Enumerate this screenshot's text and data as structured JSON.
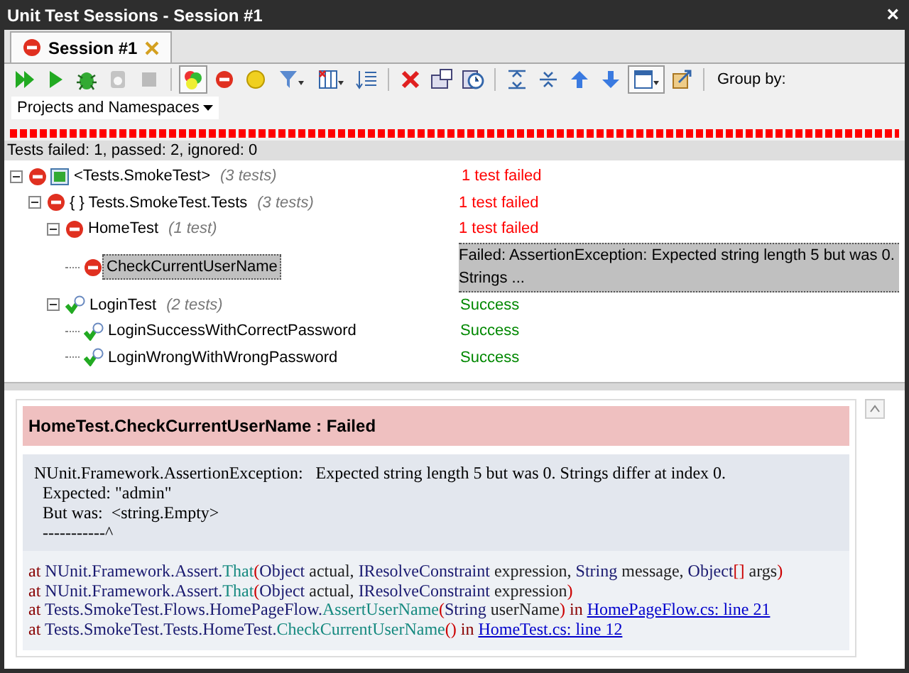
{
  "window": {
    "title": "Unit Test Sessions - Session #1",
    "close": "×"
  },
  "tabs": [
    {
      "label": "Session #1",
      "selected": true,
      "failed": true
    }
  ],
  "toolbar": {
    "buttons": [
      {
        "kind": "run-all",
        "pressed": false,
        "disabled": false
      },
      {
        "kind": "run",
        "pressed": false,
        "disabled": false
      },
      {
        "kind": "debug",
        "pressed": false,
        "disabled": false
      },
      {
        "kind": "profile",
        "pressed": false,
        "disabled": true
      },
      {
        "kind": "stop",
        "pressed": false,
        "disabled": true
      },
      {
        "kind": "sep"
      },
      {
        "kind": "passed",
        "pressed": true,
        "disabled": false
      },
      {
        "kind": "failed",
        "pressed": false,
        "disabled": false
      },
      {
        "kind": "ignored",
        "pressed": false,
        "disabled": false
      },
      {
        "kind": "filter",
        "pressed": false,
        "disabled": false
      },
      {
        "kind": "columns",
        "pressed": false,
        "disabled": false
      },
      {
        "kind": "sort",
        "pressed": false,
        "disabled": false
      },
      {
        "kind": "sep"
      },
      {
        "kind": "remove",
        "pressed": false,
        "disabled": false
      },
      {
        "kind": "export",
        "pressed": false,
        "disabled": false
      },
      {
        "kind": "clock",
        "pressed": false,
        "disabled": false
      },
      {
        "kind": "sep"
      },
      {
        "kind": "expand",
        "pressed": false,
        "disabled": false
      },
      {
        "kind": "collapse",
        "pressed": false,
        "disabled": false
      },
      {
        "kind": "up",
        "pressed": false,
        "disabled": false
      },
      {
        "kind": "down",
        "pressed": false,
        "disabled": false
      },
      {
        "kind": "layout",
        "pressed": true,
        "disabled": false
      },
      {
        "kind": "open",
        "pressed": false,
        "disabled": false
      },
      {
        "kind": "sep"
      }
    ],
    "group_by_label": "Group by:",
    "group_by_value": "Projects and Namespaces"
  },
  "progress": {
    "level": 1,
    "failed": true
  },
  "summary": "Tests failed: 1, passed: 2, ignored: 0",
  "tree": [
    {
      "label": "<Tests.SmokeTest>",
      "count": "(3 tests)",
      "result": "1 test failed",
      "failed": true,
      "project": true,
      "expanded": true,
      "selected": false,
      "children": [
        {
          "label": "{ } Tests.SmokeTest.Tests",
          "count": "(3 tests)",
          "result": "1 test failed",
          "failed": true,
          "expanded": true,
          "selected": false,
          "children": [
            {
              "label": "HomeTest",
              "count": "(1 test)",
              "result": "1 test failed",
              "failed": true,
              "expanded": true,
              "selected": false,
              "children": [
                {
                  "label": "CheckCurrentUserName",
                  "result": "Failed: AssertionException: Expected string length 5 but was 0. Strings ...",
                  "failed": true,
                  "selected": true
                }
              ]
            },
            {
              "label": "LoginTest",
              "count": "(2 tests)",
              "result": "Success",
              "failed": false,
              "expanded": true,
              "selected": false,
              "children": [
                {
                  "label": "LoginSuccessWithCorrectPassword",
                  "result": "Success",
                  "failed": false,
                  "selected": false
                },
                {
                  "label": "LoginWrongWithWrongPassword",
                  "result": "Success",
                  "failed": false,
                  "selected": false
                }
              ]
            }
          ]
        }
      ]
    }
  ],
  "details": {
    "title": "HomeTest.CheckCurrentUserName : Failed",
    "failed": true,
    "message": [
      "NUnit.Framework.AssertionException:   Expected string length 5 but was 0. Strings differ at index 0.",
      "  Expected: \"admin\"",
      "  But was:  <string.Empty>",
      "  -----------^"
    ],
    "stack": [
      [
        {
          "kind": "kw",
          "text": "at "
        },
        {
          "kind": "type",
          "text": "NUnit.Framework.Assert."
        },
        {
          "kind": "method",
          "text": "That"
        },
        {
          "kind": "punct",
          "text": "("
        },
        {
          "kind": "type",
          "text": "Object"
        },
        {
          "kind": "plain",
          "text": " actual, "
        },
        {
          "kind": "type",
          "text": "IResolveConstraint"
        },
        {
          "kind": "plain",
          "text": " expression, "
        },
        {
          "kind": "type",
          "text": "String"
        },
        {
          "kind": "plain",
          "text": " message, "
        },
        {
          "kind": "type",
          "text": "Object"
        },
        {
          "kind": "punct",
          "text": "[]"
        },
        {
          "kind": "plain",
          "text": " args"
        },
        {
          "kind": "punct",
          "text": ")"
        }
      ],
      [
        {
          "kind": "kw",
          "text": "at "
        },
        {
          "kind": "type",
          "text": "NUnit.Framework.Assert."
        },
        {
          "kind": "method",
          "text": "That"
        },
        {
          "kind": "punct",
          "text": "("
        },
        {
          "kind": "type",
          "text": "Object"
        },
        {
          "kind": "plain",
          "text": " actual, "
        },
        {
          "kind": "type",
          "text": "IResolveConstraint"
        },
        {
          "kind": "plain",
          "text": " expression"
        },
        {
          "kind": "punct",
          "text": ")"
        }
      ],
      [
        {
          "kind": "kw",
          "text": "at "
        },
        {
          "kind": "type",
          "text": "Tests.SmokeTest.Flows.HomePageFlow."
        },
        {
          "kind": "method",
          "text": "AssertUserName"
        },
        {
          "kind": "punct",
          "text": "("
        },
        {
          "kind": "type",
          "text": "String"
        },
        {
          "kind": "plain",
          "text": " userName"
        },
        {
          "kind": "punct",
          "text": ")"
        },
        {
          "kind": "kw",
          "text": " in "
        },
        {
          "kind": "link",
          "text": "HomePageFlow.cs: line 21"
        }
      ],
      [
        {
          "kind": "kw",
          "text": "at "
        },
        {
          "kind": "type",
          "text": "Tests.SmokeTest.Tests.HomeTest."
        },
        {
          "kind": "method",
          "text": "CheckCurrentUserName"
        },
        {
          "kind": "punct",
          "text": "()"
        },
        {
          "kind": "kw",
          "text": " in "
        },
        {
          "kind": "link",
          "text": "HomeTest.cs: line 12"
        }
      ]
    ]
  }
}
